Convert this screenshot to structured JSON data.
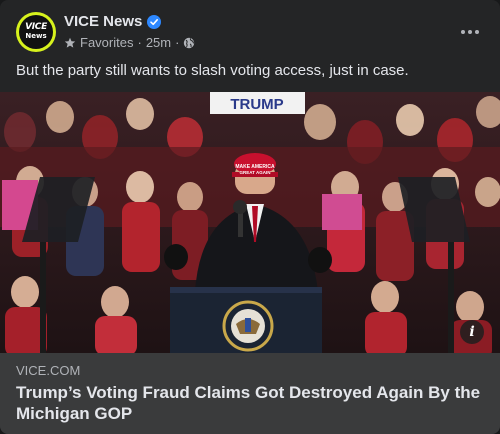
{
  "post": {
    "page_name": "VICE News",
    "avatar": {
      "line1": "VICE",
      "line2": "News"
    },
    "audience": "Favorites",
    "timestamp": "25m",
    "separator": "·",
    "text": "But the party still wants to slash voting access, just in case."
  },
  "photo": {
    "banner_text": "TRUMP",
    "hat_text_line1": "MAKE AMERICA",
    "hat_text_line2": "GREAT AGAIN"
  },
  "link_preview": {
    "domain": "VICE.COM",
    "headline": "Trump’s Voting Fraud Claims Got Destroyed Again By the Michigan GOP",
    "info_label": "i"
  },
  "colors": {
    "background": "#242526",
    "link_box": "#3a3b3c",
    "text_primary": "#e4e6eb",
    "text_secondary": "#b0b3b8",
    "verified": "#2d88ff",
    "vice_yellow": "#d7f21d"
  },
  "icons": {
    "verified": "verified-badge-icon",
    "favorites": "star-icon",
    "audience": "globe-icon",
    "more": "more-options-icon",
    "info": "info-icon"
  }
}
